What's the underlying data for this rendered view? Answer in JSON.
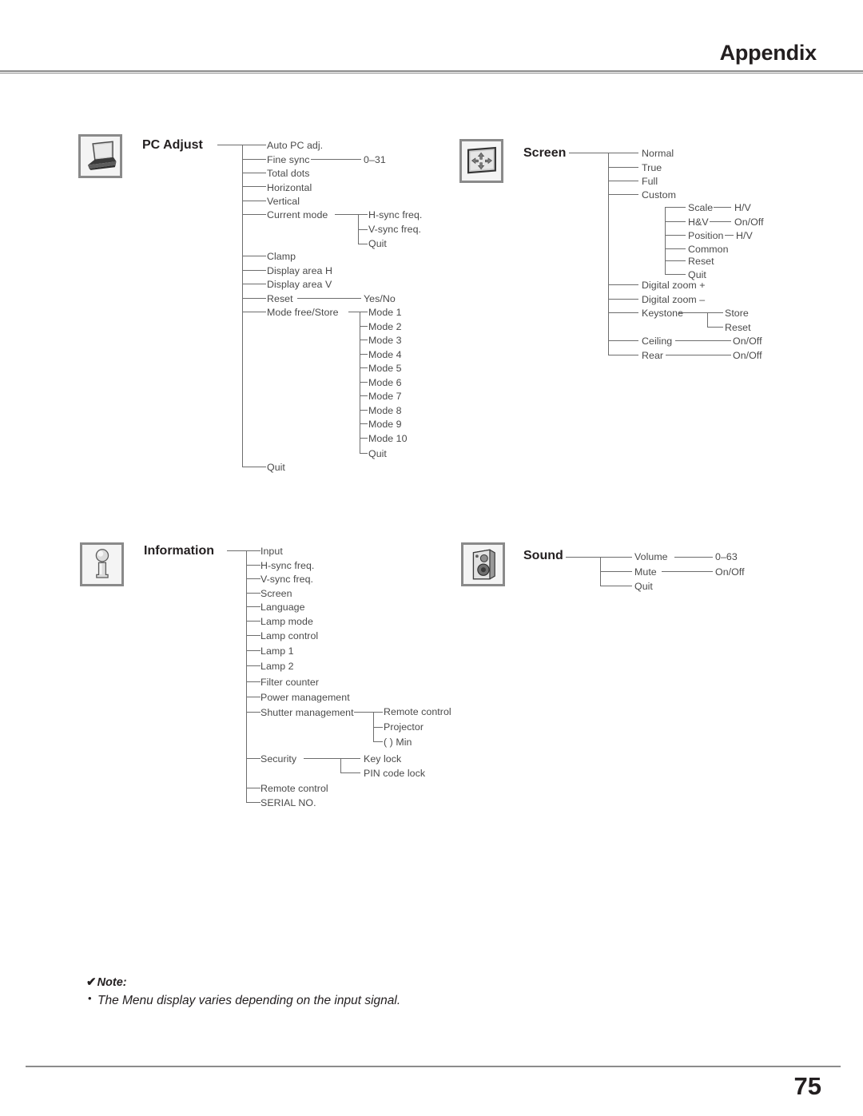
{
  "header": {
    "title": "Appendix"
  },
  "footer": {
    "page_number": "75"
  },
  "note": {
    "check_glyph": "✔",
    "heading": "Note:",
    "bullet_glyph": "•",
    "items": [
      "The Menu display varies depending on the input signal."
    ]
  },
  "menus": {
    "pc_adjust": {
      "title": "PC Adjust",
      "icon": "laptop-icon",
      "items": [
        {
          "label": "Auto PC adj."
        },
        {
          "label": "Fine sync",
          "value": "0–31"
        },
        {
          "label": "Total dots"
        },
        {
          "label": "Horizontal"
        },
        {
          "label": "Vertical"
        },
        {
          "label": "Current mode",
          "children": [
            "H-sync freq.",
            "V-sync freq.",
            "Quit"
          ]
        },
        {
          "label": "Clamp"
        },
        {
          "label": "Display area H"
        },
        {
          "label": "Display area V"
        },
        {
          "label": "Reset",
          "value": "Yes/No"
        },
        {
          "label": "Mode free/Store",
          "children": [
            "Mode 1",
            "Mode 2",
            "Mode 3",
            "Mode 4",
            "Mode 5",
            "Mode 6",
            "Mode 7",
            "Mode 8",
            "Mode 9",
            "Mode 10",
            "Quit"
          ]
        },
        {
          "label": "Quit"
        }
      ]
    },
    "screen": {
      "title": "Screen",
      "icon": "screen-icon",
      "items": [
        {
          "label": "Normal"
        },
        {
          "label": "True"
        },
        {
          "label": "Full"
        },
        {
          "label": "Custom",
          "children": [
            {
              "label": "Scale",
              "value": "H/V"
            },
            {
              "label": "H&V",
              "value": "On/Off"
            },
            {
              "label": "Position",
              "value": "H/V"
            },
            {
              "label": "Common"
            },
            {
              "label": "Reset"
            },
            {
              "label": "Quit"
            }
          ]
        },
        {
          "label": "Digital zoom +"
        },
        {
          "label": "Digital zoom –"
        },
        {
          "label": "Keystone",
          "children": [
            "Store",
            "Reset"
          ]
        },
        {
          "label": "Ceiling",
          "value": "On/Off"
        },
        {
          "label": "Rear",
          "value": "On/Off"
        }
      ]
    },
    "information": {
      "title": "Information",
      "icon": "information-icon",
      "items": [
        {
          "label": "Input"
        },
        {
          "label": "H-sync freq."
        },
        {
          "label": "V-sync freq."
        },
        {
          "label": "Screen"
        },
        {
          "label": "Language"
        },
        {
          "label": "Lamp mode"
        },
        {
          "label": "Lamp control"
        },
        {
          "label": "Lamp 1"
        },
        {
          "label": "Lamp 2"
        },
        {
          "label": "Filter counter"
        },
        {
          "label": "Power management"
        },
        {
          "label": "Shutter management",
          "children": [
            "Remote control",
            "Projector",
            "(    ) Min"
          ]
        },
        {
          "label": "Security",
          "children": [
            "Key lock",
            "PIN code lock"
          ]
        },
        {
          "label": "Remote control"
        },
        {
          "label": "SERIAL NO."
        }
      ]
    },
    "sound": {
      "title": "Sound",
      "icon": "speaker-icon",
      "items": [
        {
          "label": "Volume",
          "value": "0–63"
        },
        {
          "label": "Mute",
          "value": "On/Off"
        },
        {
          "label": "Quit"
        }
      ]
    }
  }
}
